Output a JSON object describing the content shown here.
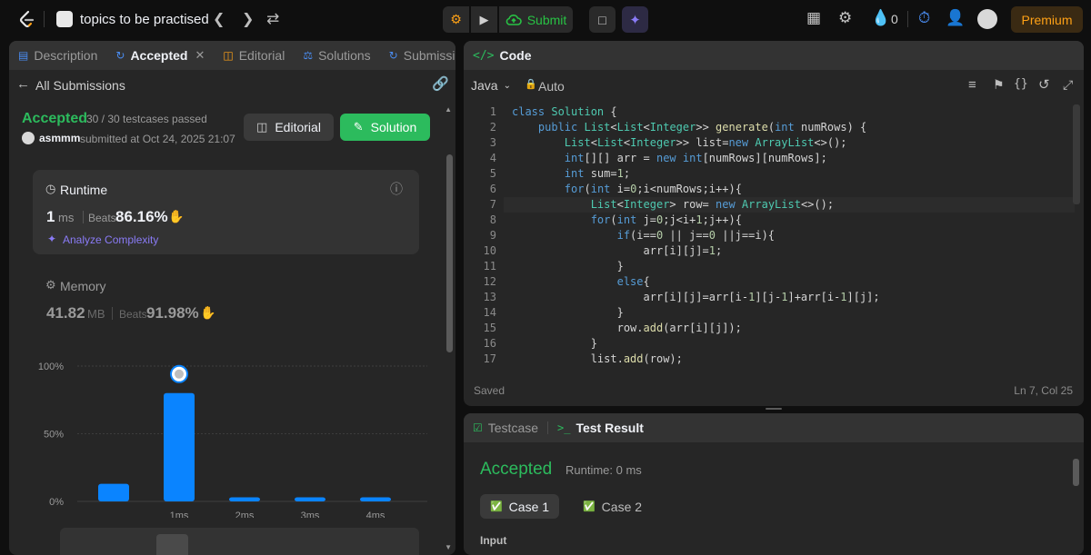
{
  "topbar": {
    "playlist_title": "topics to be practised",
    "submit_label": "Submit",
    "points": "0",
    "premium_label": "Premium"
  },
  "left": {
    "tabs": [
      {
        "label": "Description"
      },
      {
        "label": "Accepted"
      },
      {
        "label": "Editorial"
      },
      {
        "label": "Solutions"
      },
      {
        "label": "Submission"
      }
    ],
    "back_label": "All Submissions",
    "status": "Accepted",
    "testcases": "30 / 30 testcases passed",
    "user": "asmmm",
    "submitted_at": "submitted at Oct 24, 2025 21:07",
    "editorial_btn": "Editorial",
    "solution_btn": "Solution",
    "runtime": {
      "title": "Runtime",
      "value": "1",
      "unit": "ms",
      "beats_label": "Beats",
      "beats": "86.16%",
      "analyze": "Analyze Complexity"
    },
    "memory": {
      "title": "Memory",
      "value": "41.82",
      "unit": "MB",
      "beats_label": "Beats",
      "beats": "91.98%"
    }
  },
  "chart_data": {
    "type": "bar",
    "categories": [
      "",
      "1ms",
      "2ms",
      "3ms",
      "4ms"
    ],
    "values": [
      13,
      80,
      3,
      3,
      3
    ],
    "ylim": [
      0,
      100
    ],
    "yticks": [
      "100%",
      "50%",
      "0%"
    ],
    "highlight_index": 1
  },
  "code": {
    "title": "Code",
    "language": "Java",
    "mode": "Auto",
    "saved": "Saved",
    "cursor": "Ln 7, Col 25",
    "lines": [
      "class Solution {",
      "    public List<List<Integer>> generate(int numRows) {",
      "        List<List<Integer>> list=new ArrayList<>();",
      "        int[][] arr = new int[numRows][numRows];",
      "        int sum=1;",
      "        for(int i=0;i<numRows;i++){",
      "            List<Integer> row= new ArrayList<>();",
      "            for(int j=0;j<i+1;j++){",
      "                if(i==0 || j==0 ||j==i){",
      "                    arr[i][j]=1;",
      "                }",
      "                else{",
      "                    arr[i][j]=arr[i-1][j-1]+arr[i-1][j];",
      "                }",
      "                row.add(arr[i][j]);",
      "            }",
      "            list.add(row);"
    ]
  },
  "test": {
    "tab_testcase": "Testcase",
    "tab_result": "Test Result",
    "status": "Accepted",
    "runtime": "Runtime: 0 ms",
    "cases": [
      "Case 1",
      "Case 2"
    ],
    "input_label": "Input"
  }
}
